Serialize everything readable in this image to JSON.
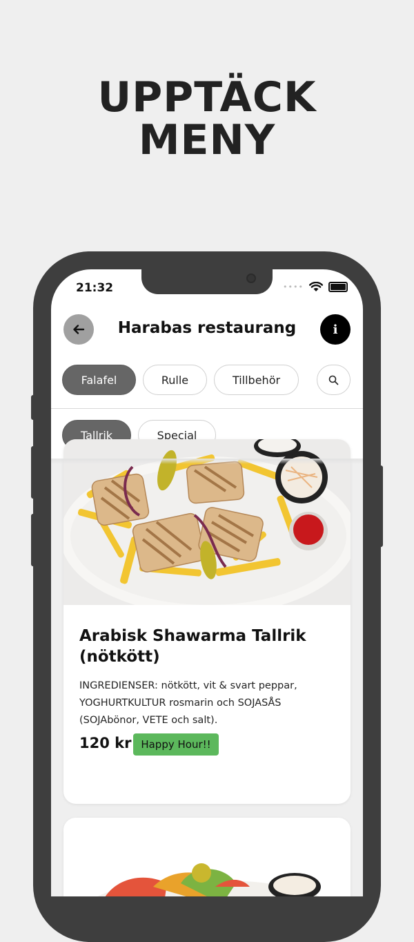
{
  "promo": {
    "line1": "UPPTÄCK",
    "line2": "MENY"
  },
  "status_bar": {
    "time": "21:32"
  },
  "header": {
    "title": "Harabas restaurang",
    "info_label": "i"
  },
  "categories": [
    {
      "label": "Falafel",
      "active": true
    },
    {
      "label": "Rulle",
      "active": false
    },
    {
      "label": "Tillbehör",
      "active": false
    }
  ],
  "subcategories": [
    {
      "label": "Tallrik",
      "active": true
    },
    {
      "label": "Special",
      "active": false
    }
  ],
  "menu_items": [
    {
      "name": "Arabisk Shawarma Tallrik (nötkött)",
      "description": "INGREDIENSER: nötkött, vit & svart peppar, YOGHURTKULTUR rosmarin och SOJASÅS (SOJAbönor, VETE och salt).",
      "price": "120 kr",
      "badge": "Happy Hour!!"
    }
  ],
  "colors": {
    "background": "#efefef",
    "active_chip": "#666666",
    "badge": "#5cb85c",
    "phone_frame": "#3e3e3e"
  }
}
